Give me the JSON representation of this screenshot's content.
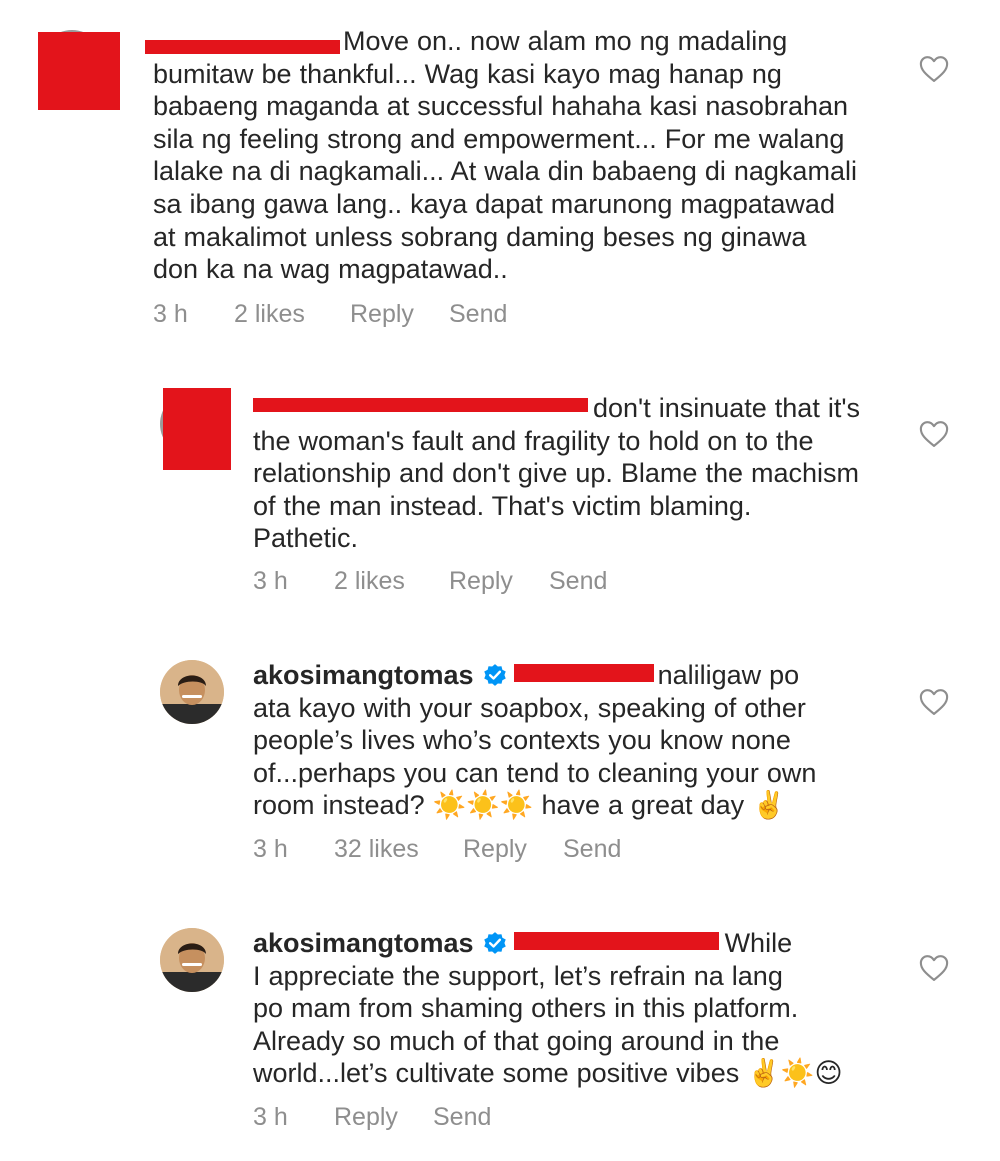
{
  "comments": [
    {
      "text_lines": [
        "Move on.. now alam mo ng madaling",
        "bumitaw be thankful... Wag kasi kayo mag hanap ng",
        "babaeng maganda at successful hahaha kasi nasobrahan",
        "sila ng feeling strong and empowerment... For me walang",
        "lalake na di nagkamali... At wala din babaeng di nagkamali",
        "sa ibang gawa lang.. kaya dapat marunong magpatawad",
        "at makalimot unless sobrang daming beses ng ginawa",
        "don ka na wag magpatawad.."
      ],
      "time": "3 h",
      "likes": "2 likes",
      "reply": "Reply",
      "send": "Send"
    },
    {
      "text_lines": [
        "don't insinuate that it's",
        "the woman's fault and fragility to hold on to the",
        "relationship and don't give up. Blame the machism",
        "of the man instead. That's victim blaming.",
        "Pathetic."
      ],
      "time": "3 h",
      "likes": "2 likes",
      "reply": "Reply",
      "send": "Send"
    },
    {
      "username": "akosimangtomas",
      "text_lines": [
        "naliligaw po",
        "ata kayo with your soapbox, speaking of other",
        "people’s lives who’s contexts you know none",
        "of...perhaps you can tend to cleaning your own",
        "room instead? ☀️☀️☀️ have a great day ✌️"
      ],
      "time": "3 h",
      "likes": "32 likes",
      "reply": "Reply",
      "send": "Send"
    },
    {
      "username": "akosimangtomas",
      "text_lines": [
        "While",
        "I appreciate the support, let’s refrain na lang",
        "po mam from shaming others in this platform.",
        "Already so much of that going around in the",
        "world...let’s cultivate some positive vibes ✌️☀️😊"
      ],
      "time": "3 h",
      "reply": "Reply",
      "send": "Send"
    }
  ],
  "colors": {
    "text": "#262626",
    "meta": "#8e8e8e",
    "redaction": "#e3141b",
    "verified": "#0095f6",
    "heart": "#8e8e8e"
  },
  "icons": {
    "like": "heart-outline-icon",
    "verified": "verified-badge-icon"
  }
}
